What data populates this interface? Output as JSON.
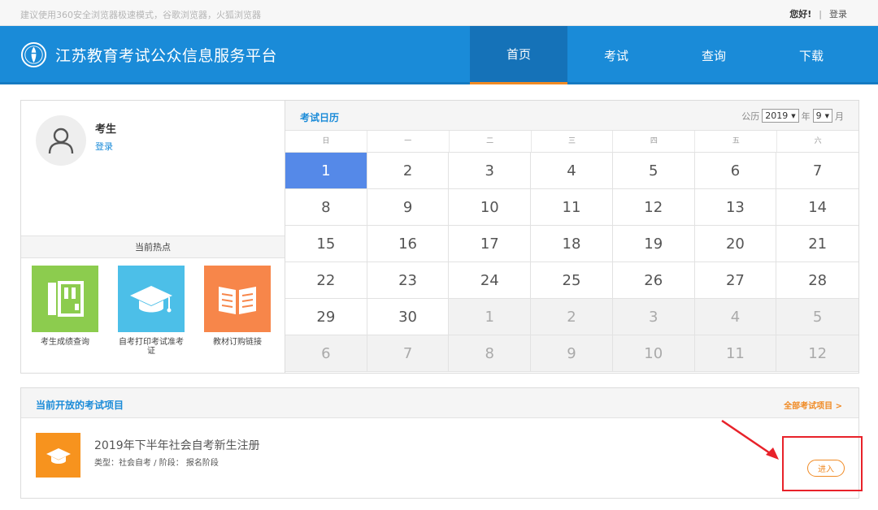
{
  "topbar": {
    "notice": "建议使用360安全浏览器极速模式，谷歌浏览器，火狐浏览器",
    "hello": "您好!",
    "separator": "|",
    "login": "登录"
  },
  "header": {
    "title": "江苏教育考试公众信息服务平台",
    "nav": [
      "首页",
      "考试",
      "查询",
      "下载"
    ],
    "active_nav": "首页",
    "colors": {
      "header_bg": "#1a8bd8",
      "active_tab_bg": "#1572b8",
      "active_underline": "#f08a24"
    }
  },
  "profile": {
    "name": "考生",
    "login": "登录",
    "avatar_icon": "user-icon"
  },
  "hot": {
    "title": "当前热点",
    "items": [
      {
        "label": "考生成绩查询",
        "icon": "notebook-icon",
        "color": "#8ccc4e"
      },
      {
        "label": "自考打印考试准考证",
        "icon": "graduation-cap-icon",
        "color": "#4cbfe8"
      },
      {
        "label": "教材订购链接",
        "icon": "open-book-icon",
        "color": "#f7864a"
      }
    ]
  },
  "calendar": {
    "title": "考试日历",
    "prefix": "公历",
    "year": "2019",
    "year_unit": "年",
    "month": "9",
    "month_unit": "月",
    "weekdays": [
      "日",
      "一",
      "二",
      "三",
      "四",
      "五",
      "六"
    ],
    "days": [
      {
        "d": "1",
        "type": "today"
      },
      {
        "d": "2",
        "type": "cur"
      },
      {
        "d": "3",
        "type": "cur"
      },
      {
        "d": "4",
        "type": "cur"
      },
      {
        "d": "5",
        "type": "cur"
      },
      {
        "d": "6",
        "type": "cur"
      },
      {
        "d": "7",
        "type": "cur"
      },
      {
        "d": "8",
        "type": "cur"
      },
      {
        "d": "9",
        "type": "cur"
      },
      {
        "d": "10",
        "type": "cur"
      },
      {
        "d": "11",
        "type": "cur"
      },
      {
        "d": "12",
        "type": "cur"
      },
      {
        "d": "13",
        "type": "cur"
      },
      {
        "d": "14",
        "type": "cur"
      },
      {
        "d": "15",
        "type": "cur"
      },
      {
        "d": "16",
        "type": "cur"
      },
      {
        "d": "17",
        "type": "cur"
      },
      {
        "d": "18",
        "type": "cur"
      },
      {
        "d": "19",
        "type": "cur"
      },
      {
        "d": "20",
        "type": "cur"
      },
      {
        "d": "21",
        "type": "cur"
      },
      {
        "d": "22",
        "type": "cur"
      },
      {
        "d": "23",
        "type": "cur"
      },
      {
        "d": "24",
        "type": "cur"
      },
      {
        "d": "25",
        "type": "cur"
      },
      {
        "d": "26",
        "type": "cur"
      },
      {
        "d": "27",
        "type": "cur"
      },
      {
        "d": "28",
        "type": "cur"
      },
      {
        "d": "29",
        "type": "cur"
      },
      {
        "d": "30",
        "type": "cur"
      },
      {
        "d": "1",
        "type": "other"
      },
      {
        "d": "2",
        "type": "other"
      },
      {
        "d": "3",
        "type": "other"
      },
      {
        "d": "4",
        "type": "other"
      },
      {
        "d": "5",
        "type": "other"
      },
      {
        "d": "6",
        "type": "other"
      },
      {
        "d": "7",
        "type": "other"
      },
      {
        "d": "8",
        "type": "other"
      },
      {
        "d": "9",
        "type": "other"
      },
      {
        "d": "10",
        "type": "other"
      },
      {
        "d": "11",
        "type": "other"
      },
      {
        "d": "12",
        "type": "other"
      }
    ],
    "today_color": "#5589e8"
  },
  "projects": {
    "title": "当前开放的考试项目",
    "all_link": "全部考试项目 >",
    "items": [
      {
        "name": "2019年下半年社会自考新生注册",
        "meta": "类型：社会自考 / 阶段： 报名阶段",
        "button": "进入",
        "icon": "graduation-cap-icon",
        "color": "#f7931e"
      }
    ],
    "annotation_color": "#e8222a"
  }
}
